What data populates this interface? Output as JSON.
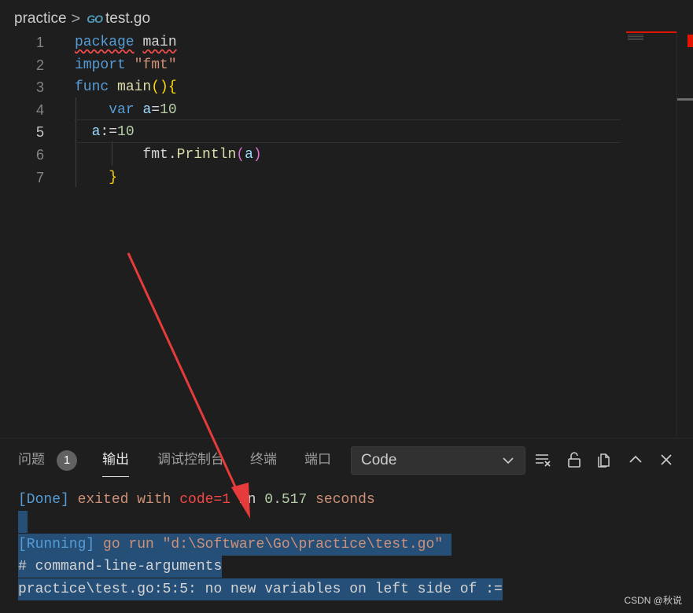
{
  "breadcrumb": {
    "folder": "practice",
    "separator": ">",
    "file_icon": "GO",
    "file": "test.go"
  },
  "editor": {
    "lines": [
      {
        "n": "1",
        "tokens": [
          [
            "kw squiggle",
            "package"
          ],
          [
            "plain",
            " "
          ],
          [
            "plain squiggle",
            "main"
          ]
        ]
      },
      {
        "n": "2",
        "tokens": [
          [
            "kw",
            "import"
          ],
          [
            "plain",
            " "
          ],
          [
            "str",
            "\"fmt\""
          ]
        ]
      },
      {
        "n": "3",
        "tokens": [
          [
            "kw",
            "func"
          ],
          [
            "plain",
            " "
          ],
          [
            "fn",
            "main"
          ],
          [
            "br",
            "(){"
          ]
        ]
      },
      {
        "n": "4",
        "tokens": [
          [
            "plain",
            "    "
          ],
          [
            "kw",
            "var"
          ],
          [
            "plain",
            " "
          ],
          [
            "var",
            "a"
          ],
          [
            "plain",
            "="
          ],
          [
            "num",
            "10"
          ]
        ]
      },
      {
        "n": "5",
        "tokens": [
          [
            "plain",
            "  "
          ],
          [
            "var",
            "a"
          ],
          [
            "plain",
            ":="
          ],
          [
            "num",
            "10"
          ]
        ]
      },
      {
        "n": "6",
        "tokens": [
          [
            "plain",
            "        "
          ],
          [
            "plain",
            "fmt."
          ],
          [
            "fn",
            "Println"
          ],
          [
            "br2",
            "("
          ],
          [
            "var",
            "a"
          ],
          [
            "br2",
            ")"
          ]
        ]
      },
      {
        "n": "7",
        "tokens": [
          [
            "plain",
            "    "
          ],
          [
            "br",
            "}"
          ]
        ]
      }
    ],
    "active_line": "5"
  },
  "panel": {
    "tabs": {
      "problems": "问题",
      "problems_count": "1",
      "output": "输出",
      "debug_console": "调试控制台",
      "terminal": "终端",
      "ports": "端口"
    },
    "channel": "Code",
    "output": {
      "done_tag": "[Done]",
      "done_text": " exited with ",
      "done_code": "code=1",
      "done_in": " in ",
      "done_time": "0.517",
      "done_unit": " seconds",
      "running_tag": "[Running]",
      "running_cmd": " go run \"d:\\Software\\Go\\practice\\test.go\"",
      "line3": "# command-line-arguments",
      "line4": "practice\\test.go:5:5: no new variables on left side of :="
    }
  },
  "watermark": "CSDN @秋说"
}
